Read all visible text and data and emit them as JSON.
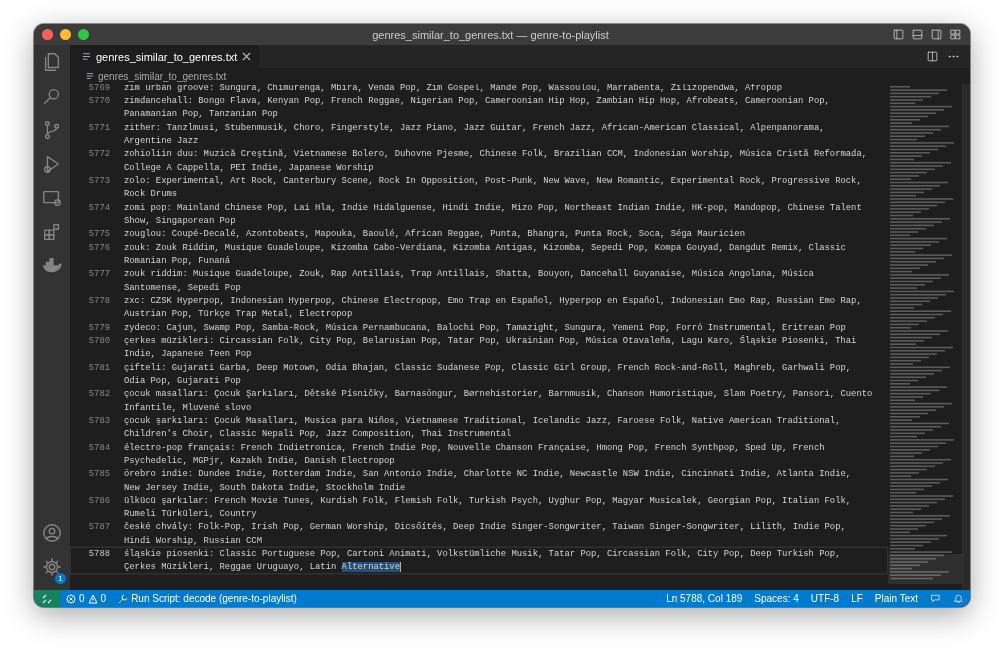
{
  "window": {
    "title": "genres_similar_to_genres.txt — genre-to-playlist"
  },
  "activity_bar": {
    "settings_badge": "1"
  },
  "tabs": [
    {
      "label": "genres_similar_to_genres.txt",
      "selected": true
    }
  ],
  "breadcrumb": [
    "genres_similar_to_genres.txt"
  ],
  "editor": {
    "lines": [
      {
        "number": "5769",
        "current": false,
        "wraps": [
          "zim urban groove: Sungura, Chimurenga, Mbira, Venda Pop, Zim Gospel, Mande Pop, Wassoulou, Marrabenta, Zilizopendwa, Afropop"
        ]
      },
      {
        "number": "5770",
        "current": false,
        "wraps": [
          "zimdancehall: Bongo Flava, Kenyan Pop, French Reggae, Nigerian Pop, Cameroonian Hip Hop, Zambian Hip Hop, Afrobeats, Cameroonian Pop,",
          "Panamanian Pop, Tanzanian Pop"
        ]
      },
      {
        "number": "5771",
        "current": false,
        "wraps": [
          "zither: Tanzlmusi, Stubenmusik, Choro, Fingerstyle, Jazz Piano, Jazz Guitar, French Jazz, African-American Classical, Alpenpanorama,",
          "Argentine Jazz"
        ]
      },
      {
        "number": "5772",
        "current": false,
        "wraps": [
          "zohioliin duu: Muzică Creştină, Vietnamese Bolero, Duhovne Pjesme, Chinese Folk, Brazilian CCM, Indonesian Worship, Música Cristã Reformada,",
          "College A Cappella, PEI Indie, Japanese Worship"
        ]
      },
      {
        "number": "5773",
        "current": false,
        "wraps": [
          "zolo: Experimental, Art Rock, Canterbury Scene, Rock In Opposition, Post-Punk, New Wave, New Romantic, Experimental Rock, Progressive Rock,",
          "Rock Drums"
        ]
      },
      {
        "number": "5774",
        "current": false,
        "wraps": [
          "zomi pop: Mainland Chinese Pop, Lai Hla, Indie Hidalguense, Hindi Indie, Mizo Pop, Northeast Indian Indie, HK-pop, Mandopop, Chinese Talent",
          "Show, Singaporean Pop"
        ]
      },
      {
        "number": "5775",
        "current": false,
        "wraps": [
          "zouglou: Coupé-Decalé, Azontobeats, Mapouka, Baoulé, African Reggae, Punta, Bhangra, Punta Rock, Soca, Séga Mauricien"
        ]
      },
      {
        "number": "5776",
        "current": false,
        "wraps": [
          "zouk: Zouk Riddim, Musique Guadeloupe, Kizomba Cabo-Verdiana, Kizomba Antigas, Kizomba, Sepedi Pop, Kompa Gouyad, Dangdut Remix, Classic",
          "Romanian Pop, Funaná"
        ]
      },
      {
        "number": "5777",
        "current": false,
        "wraps": [
          "zouk riddim: Musique Guadeloupe, Zouk, Rap Antillais, Trap Antillais, Shatta, Bouyon, Dancehall Guyanaise, Música Angolana, Música",
          "Santomense, Sepedi Pop"
        ]
      },
      {
        "number": "5778",
        "current": false,
        "wraps": [
          "zxc: CZSK Hyperpop, Indonesian Hyperpop, Chinese Electropop, Emo Trap en Español, Hyperpop en Español, Indonesian Emo Rap, Russian Emo Rap,",
          "Austrian Pop, Türkçe Trap Metal, Electropop"
        ]
      },
      {
        "number": "5779",
        "current": false,
        "wraps": [
          "zydeco: Cajun, Swamp Pop, Samba-Rock, Música Pernambucana, Balochi Pop, Tamazight, Sungura, Yemeni Pop, Forró Instrumental, Eritrean Pop"
        ]
      },
      {
        "number": "5780",
        "current": false,
        "wraps": [
          "çerkes müzikleri: Circassian Folk, City Pop, Belarusian Pop, Tatar Pop, Ukrainian Pop, Música Otavaleña, Lagu Karo, Śląskie Piosenki, Thai",
          "Indie, Japanese Teen Pop"
        ]
      },
      {
        "number": "5781",
        "current": false,
        "wraps": [
          "çifteli: Gujarati Garba, Deep Motown, Odia Bhajan, Classic Sudanese Pop, Classic Girl Group, French Rock-and-Roll, Maghreb, Garhwali Pop,",
          "Odia Pop, Gujarati Pop"
        ]
      },
      {
        "number": "5782",
        "current": false,
        "wraps": [
          "çocuk masalları: Çocuk Şarkıları, Dětské Písničky, Barnasöngur, Børnehistorier, Barnmusik, Chanson Humoristique, Slam Poetry, Pansori, Cuento",
          "Infantile, Mluvené slovo"
        ]
      },
      {
        "number": "5783",
        "current": false,
        "wraps": [
          "çocuk şarkıları: Çocuk Masalları, Musica para Niños, Vietnamese Traditional, Icelandic Jazz, Faroese Folk, Native American Traditional,",
          "Children's Choir, Classic Nepali Pop, Jazz Composition, Thai Instrumental"
        ]
      },
      {
        "number": "5784",
        "current": false,
        "wraps": [
          "électro-pop français: French Indietronica, French Indie Pop, Nouvelle Chanson Française, Hmong Pop, French Synthpop, Sped Up, French",
          "Psychedelic, MGPjr, Kazakh Indie, Danish Electropop"
        ]
      },
      {
        "number": "5785",
        "current": false,
        "wraps": [
          "örebro indie: Dundee Indie, Rotterdam Indie, San Antonio Indie, Charlotte NC Indie, Newcastle NSW Indie, Cincinnati Indie, Atlanta Indie,",
          "New Jersey Indie, South Dakota Indie, Stockholm Indie"
        ]
      },
      {
        "number": "5786",
        "current": false,
        "wraps": [
          "ülkücü şarkılar: French Movie Tunes, Kurdish Folk, Flemish Folk, Turkish Psych, Uyghur Pop, Magyar Musicalek, Georgian Pop, Italian Folk,",
          "Rumeli Türküleri, Country"
        ]
      },
      {
        "number": "5787",
        "current": false,
        "wraps": [
          "české chvály: Folk-Pop, Irish Pop, German Worship, Dicsőítés, Deep Indie Singer-Songwriter, Taiwan Singer-Songwriter, Lilith, Indie Pop,",
          "Hindi Worship, Russian CCM"
        ]
      },
      {
        "number": "5788",
        "current": true,
        "wraps": [
          "śląskie piosenki: Classic Portuguese Pop, Cartoni Animati, Volkstümliche Musik, Tatar Pop, Circassian Folk, City Pop, Deep Turkish Pop,",
          "Çerkes Müzikleri, Reggae Uruguayo, Latin"
        ],
        "selection": "Alternative"
      }
    ]
  },
  "status_bar": {
    "errors": "0",
    "warnings": "0",
    "run_script": "Run Script: decode (genre-to-playlist)",
    "position": "Ln 5788, Col 189",
    "indent": "Spaces: 4",
    "encoding": "UTF-8",
    "eol": "LF",
    "language": "Plain Text"
  }
}
